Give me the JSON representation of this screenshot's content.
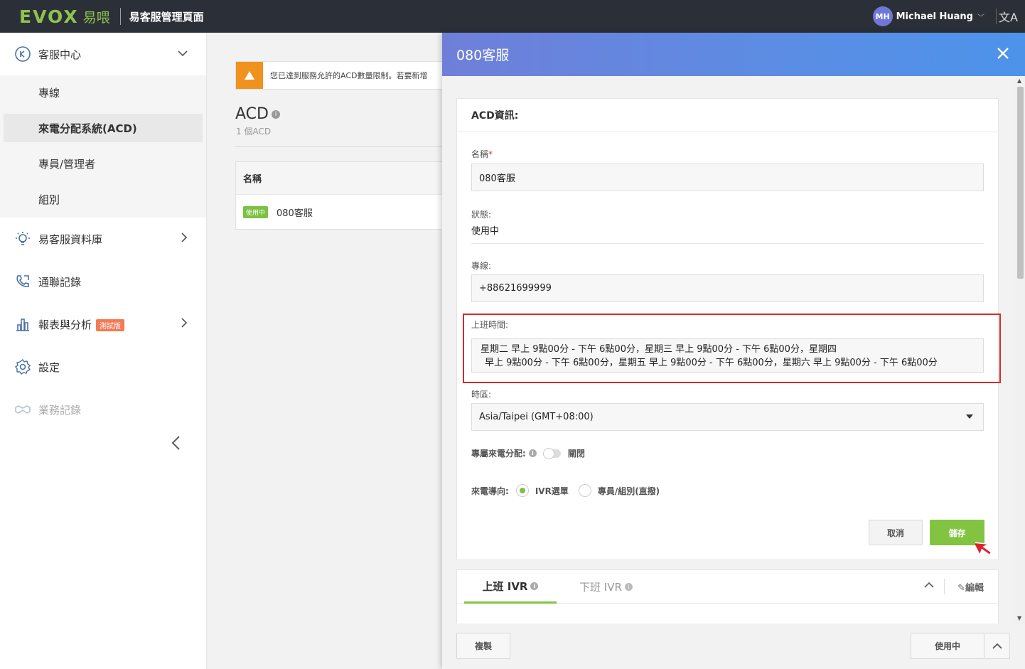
{
  "topbar": {
    "logo_text": "EVOX",
    "logo_cn": "易喂",
    "title": "易客服管理頁面",
    "user_initials": "MH",
    "user_name": "Michael Huang",
    "user_caret": "﹀",
    "lang_icon": "文A"
  },
  "sidebar": {
    "customer_center": "客服中心",
    "sub_items": [
      "專線",
      "來電分配系統(ACD)",
      "專員/管理者",
      "組別"
    ],
    "knowledge_base": "易客服資料庫",
    "call_logs": "通聯記錄",
    "reports": "報表與分析",
    "reports_badge": "測試版",
    "settings": "設定",
    "business_records": "業務記錄"
  },
  "main": {
    "alert_text": "您已達到服務允許的ACD數量限制。若要新增",
    "title": "ACD",
    "count": "1 個ACD",
    "table_header": "名稱",
    "row_status": "使用中",
    "row_name": "080客服"
  },
  "drawer": {
    "title": "080客服",
    "section_title": "ACD資訊:",
    "name_label": "名稱",
    "name_value": "080客服",
    "status_label": "狀態:",
    "status_value": "使用中",
    "line_label": "專線:",
    "line_value": "+88621699999",
    "hours_label": "上班時間:",
    "hours_line1": "星期二  早上 9點00分 - 下午 6點00分，星期三  早上 9點00分 - 下午 6點00分，星期四",
    "hours_line2": "早上 9點00分 - 下午 6點00分，星期五  早上 9點00分 - 下午 6點00分，星期六  早上 9點00分 - 下午 6點00分",
    "timezone_label": "時區:",
    "timezone_value": "Asia/Taipei (GMT+08:00)",
    "dedicated_label": "專屬來電分配:",
    "dedicated_state": "關閉",
    "routing_label": "來電導向:",
    "routing_option1": "IVR選單",
    "routing_option2": "專員/組別(直撥)",
    "cancel_label": "取消",
    "save_label": "儲存",
    "ivr_tab_on": "上班 IVR",
    "ivr_tab_off": "下班 IVR",
    "edit_label": "編輯",
    "copy_label": "複製",
    "status_button": "使用中"
  },
  "colors": {
    "brand_green": "#82c341",
    "topbar_bg": "#2b3038",
    "alert_orange": "#f0921e",
    "highlight_red": "#d62b2b"
  }
}
